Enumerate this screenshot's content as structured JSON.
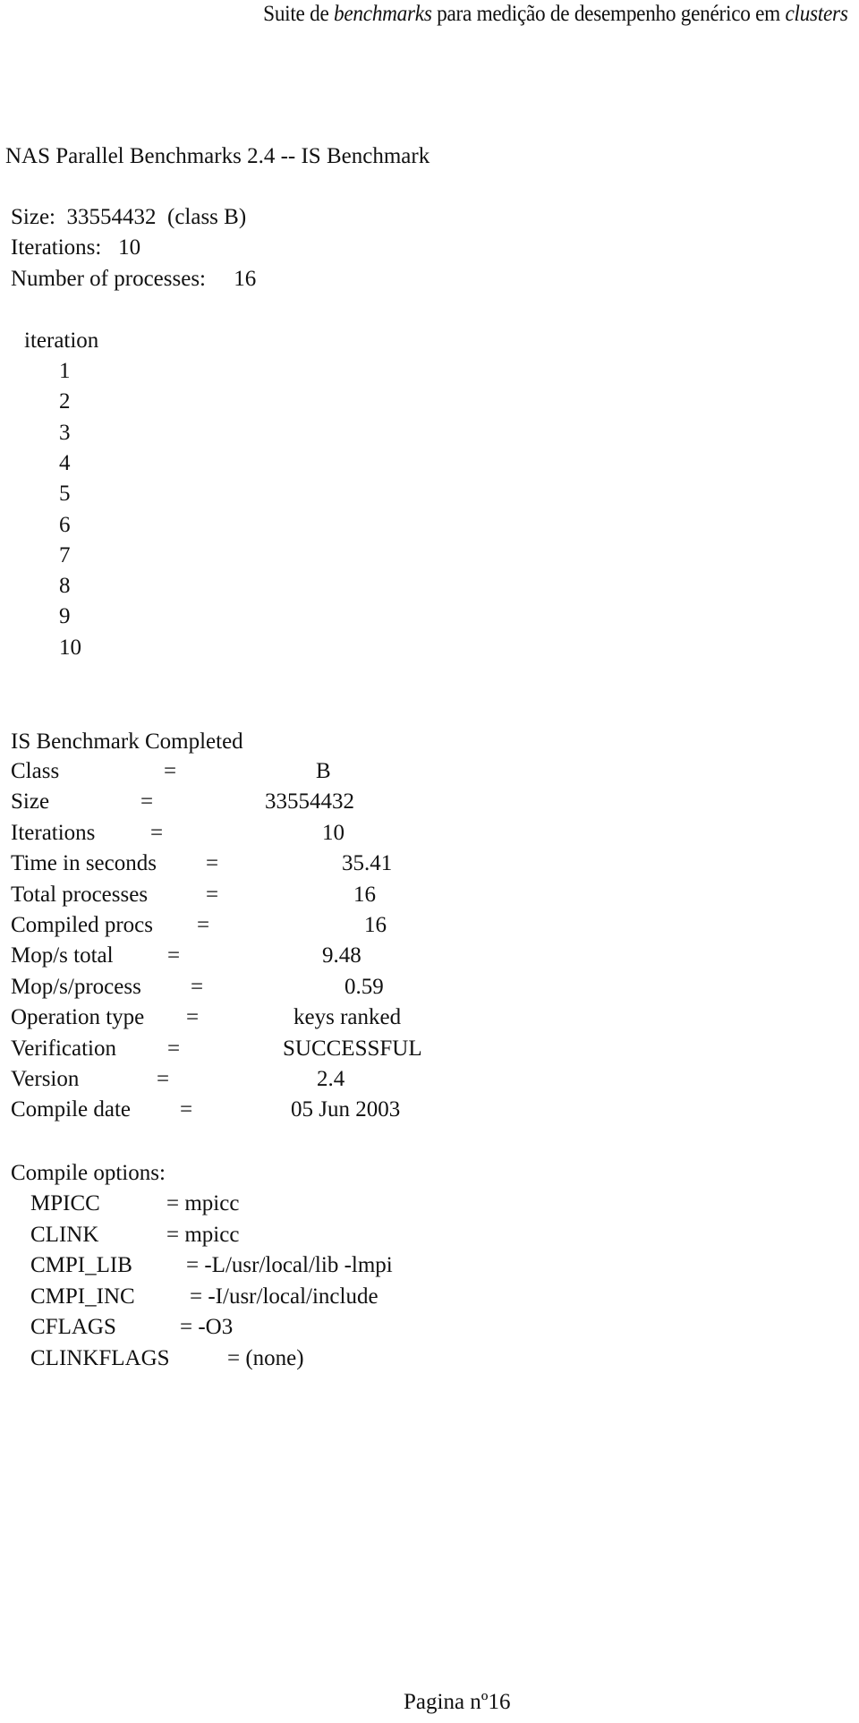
{
  "header": {
    "part1": "Suite de ",
    "part2_italic": "benchmarks",
    "part3": " para medição de desempenho genérico em ",
    "part4_italic": "clusters"
  },
  "report": {
    "title": "NAS Parallel Benchmarks 2.4 -- IS Benchmark",
    "size_line": "Size:  33554432  (class B)",
    "iterations_line": "Iterations:   10",
    "processes_line": "Number of processes:     16",
    "iteration_header": "iteration",
    "iterations": [
      "1",
      "2",
      "3",
      "4",
      "5",
      "6",
      "7",
      "8",
      "9",
      "10"
    ],
    "completed_title": "IS Benchmark Completed",
    "results": [
      {
        "label": "Class",
        "eq": "=",
        "value": "B"
      },
      {
        "label": "Size",
        "eq": "=",
        "value": "33554432"
      },
      {
        "label": "Iterations",
        "eq": "=",
        "value": "10"
      },
      {
        "label": "Time in seconds",
        "eq": "=",
        "value": "35.41"
      },
      {
        "label": "Total processes",
        "eq": "=",
        "value": "16"
      },
      {
        "label": "Compiled procs",
        "eq": "=",
        "value": "16"
      },
      {
        "label": "Mop/s total",
        "eq": "=",
        "value": "9.48"
      },
      {
        "label": "Mop/s/process",
        "eq": "=",
        "value": "0.59"
      },
      {
        "label": "Operation type",
        "eq": "=",
        "value": "keys ranked"
      },
      {
        "label": "Verification",
        "eq": "=",
        "value": "SUCCESSFUL"
      },
      {
        "label": "Version",
        "eq": "=",
        "value": "2.4"
      },
      {
        "label": "Compile date",
        "eq": "=",
        "value": "05 Jun 2003"
      }
    ],
    "compile_options_title": "Compile options:",
    "compile_options": [
      {
        "label": "MPICC",
        "value": "= mpicc"
      },
      {
        "label": "CLINK",
        "value": "= mpicc"
      },
      {
        "label": "CMPI_LIB",
        "value": "= -L/usr/local/lib -lmpi"
      },
      {
        "label": "CMPI_INC",
        "value": "= -I/usr/local/include"
      },
      {
        "label": "CFLAGS",
        "value": "= -O3"
      },
      {
        "label": "CLINKFLAGS",
        "value": "= (none)"
      }
    ]
  },
  "footer": {
    "page_label": "Pagina nº16"
  }
}
